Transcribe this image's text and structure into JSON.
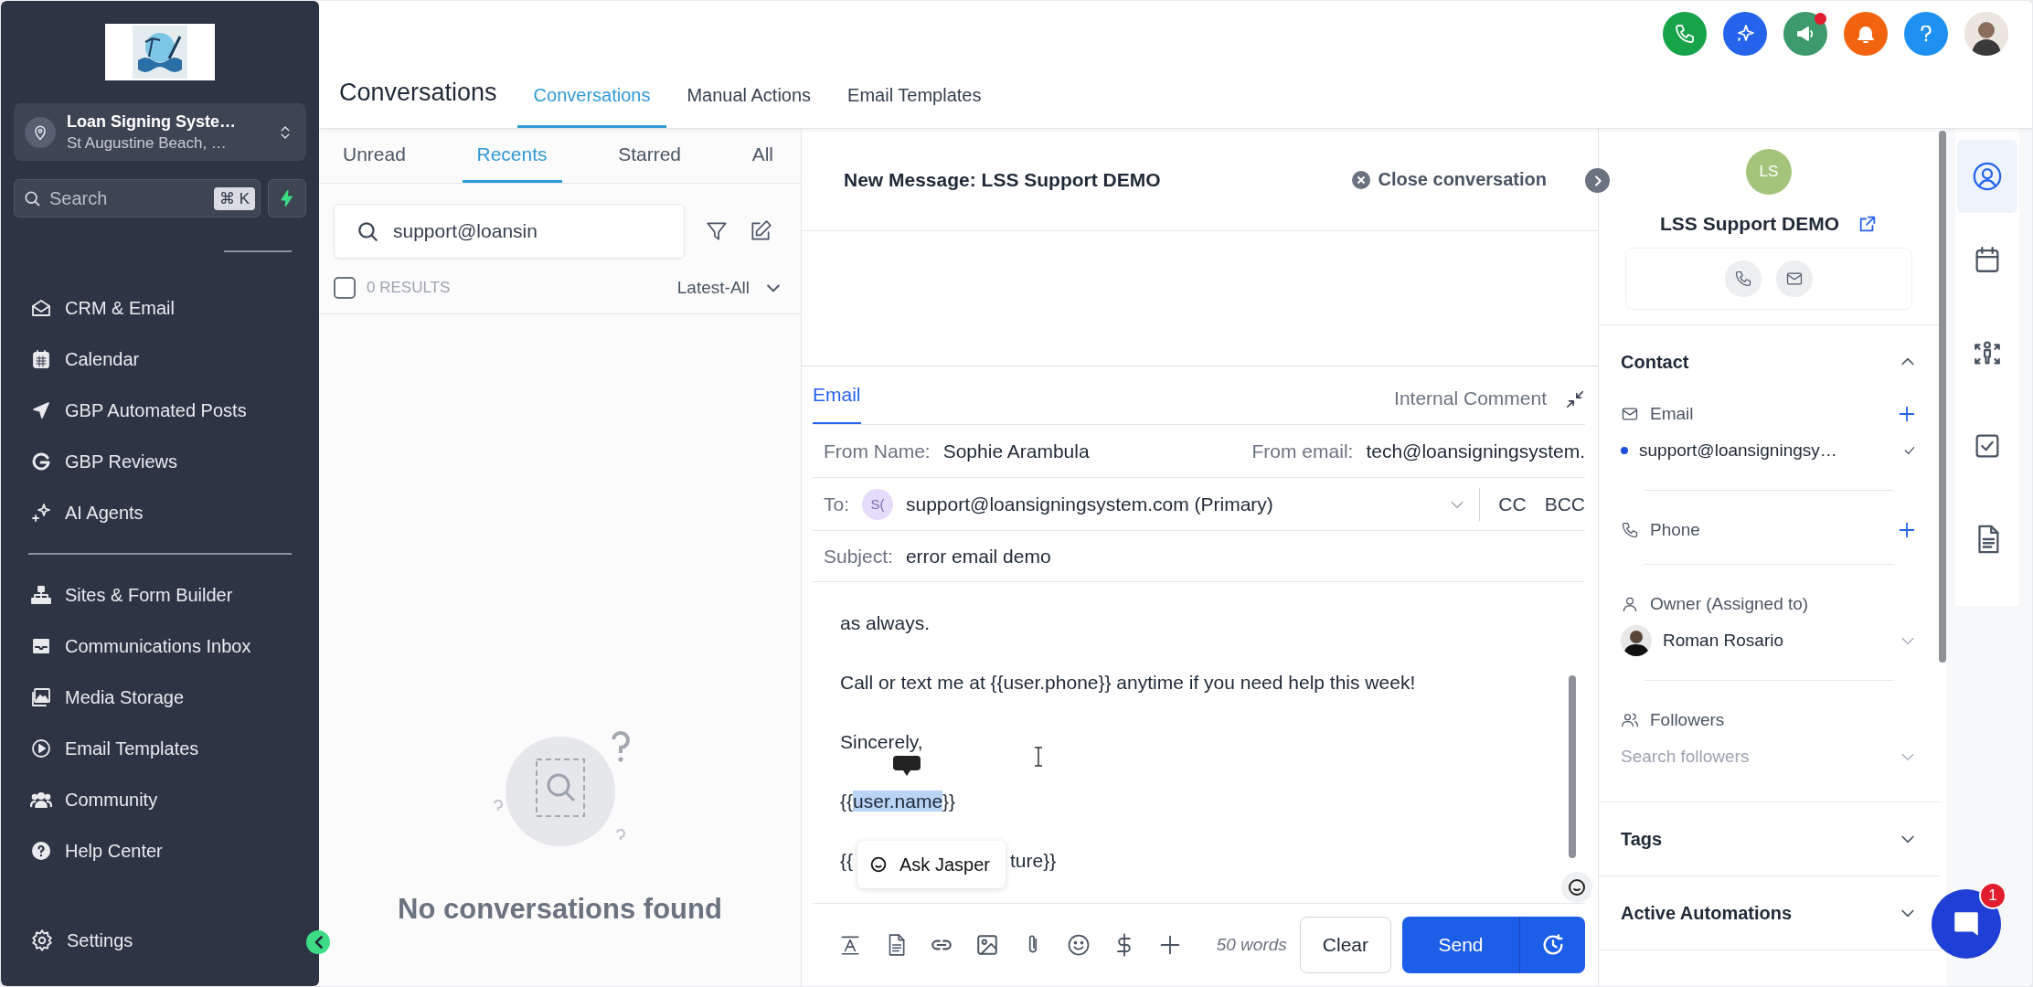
{
  "sidebar": {
    "location": {
      "name": "Loan Signing Syste…",
      "address": "St Augustine Beach, …"
    },
    "search": {
      "placeholder": "Search",
      "shortcut": "⌘ K"
    },
    "nav_groups": [
      {
        "items": [
          "CRM & Email",
          "Calendar",
          "GBP Automated Posts",
          "GBP Reviews",
          "AI Agents"
        ]
      },
      {
        "items": [
          "Sites & Form Builder",
          "Communications Inbox",
          "Media Storage",
          "Email Templates",
          "Community",
          "Help Center"
        ]
      }
    ],
    "settings": "Settings"
  },
  "header": {
    "title": "Conversations",
    "tabs": [
      {
        "label": "Conversations",
        "selected": true
      },
      {
        "label": "Manual Actions",
        "selected": false
      },
      {
        "label": "Email Templates",
        "selected": false
      }
    ]
  },
  "conversation_list": {
    "tabs": [
      {
        "label": "Unread",
        "selected": false
      },
      {
        "label": "Recents",
        "selected": true
      },
      {
        "label": "Starred",
        "selected": false
      },
      {
        "label": "All",
        "selected": false
      }
    ],
    "search": {
      "value": "support@loansin"
    },
    "select_all": {
      "checked": false
    },
    "results": "0 RESULTS",
    "sort": "Latest-All",
    "empty_message": "No conversations found"
  },
  "conversation": {
    "title": "New Message: LSS Support DEMO",
    "close": "Close conversation"
  },
  "composer": {
    "tabs": [
      {
        "label": "Email",
        "selected": true
      },
      {
        "label": "Internal Comment",
        "selected": false
      }
    ],
    "from_name_label": "From Name:",
    "from_name": "Sophie Arambula",
    "from_email_label": "From email:",
    "from_email": "tech@loansigningsystem.",
    "to_label": "To:",
    "to_initials": "S(",
    "to": "support@loansigningsystem.com (Primary)",
    "cc": "CC",
    "bcc": "BCC",
    "subject_label": "Subject:",
    "subject": "error email demo",
    "lines": [
      "as always.",
      "Call or text me at {{user.phone}} anytime if you need help this week!",
      "Sincerely,"
    ],
    "signature": {
      "before": "{{",
      "selected": "user.name",
      "after": "}}"
    },
    "last_line": {
      "start": "{{",
      "end": "ture}}"
    },
    "ask_popup": "Ask Jasper",
    "word_count": "50 words",
    "clear": "Clear",
    "send": "Send"
  },
  "contact": {
    "initials": "LS",
    "name": "LSS Support DEMO",
    "sections": [
      {
        "title": "Contact",
        "expanded": true
      },
      {
        "title": "Tags",
        "expanded": false
      },
      {
        "title": "Active Automations",
        "expanded": false
      }
    ],
    "email_label": "Email",
    "email": "support@loansigningsy…",
    "phone_label": "Phone",
    "owner_label": "Owner (Assigned to)",
    "owner": "Roman Rosario",
    "followers_label": "Followers",
    "followers_placeholder": "Search followers"
  },
  "rail": [
    {
      "selected": true
    },
    {
      "selected": false
    },
    {
      "selected": false
    },
    {
      "selected": false
    },
    {
      "selected": false
    }
  ],
  "chat": {
    "badge": "1"
  }
}
